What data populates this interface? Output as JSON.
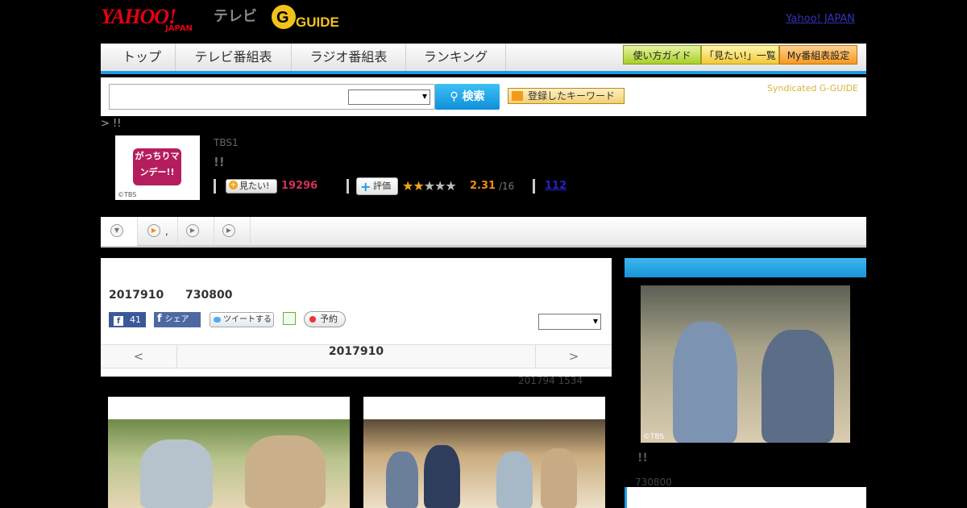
{
  "header": {
    "yahoo_logo": "YAHOO!",
    "yahoo_sub": "JAPAN",
    "tv_label": "テレビ",
    "gguide_logo": "G-GUIDE",
    "top_link": "Yahoo! JAPAN"
  },
  "nav": {
    "tabs": [
      "トップ",
      "テレビ番組表",
      "ラジオ番組表",
      "ランキング"
    ],
    "right_buttons": [
      "使い方ガイド",
      "「見たい!」一覧",
      "My番組表設定"
    ]
  },
  "search": {
    "placeholder": "",
    "button_label": "検索",
    "keyword_button": "登録したキーワード",
    "syndicated": "Syndicated G-GUIDE"
  },
  "breadcrumb": "> !!",
  "program": {
    "thumb_text": "がっちりマンデー!!",
    "thumb_credit": "©TBS",
    "station": "TBS1",
    "title": "!!",
    "mitai_label": "見たい!",
    "mitai_count": "19296",
    "hyoka_label": "評価",
    "rating": 2.31,
    "score": "2.31",
    "out_of": "/16",
    "review_count": "112"
  },
  "subtabs": [
    {
      "label": ""
    },
    {
      "label": ","
    },
    {
      "label": ""
    },
    {
      "label": ""
    }
  ],
  "panel": {
    "date": "2017910",
    "number": "730800",
    "fb_count": "41",
    "share_label": "シェア",
    "tweet_label": "ツイートする",
    "reserve_label": "予約",
    "pager_prev": "<",
    "pager_date": "2017910",
    "pager_next": ">",
    "updated": "201794  1534"
  },
  "side": {
    "credit": "©TBS",
    "title": "!!",
    "number": "730800"
  },
  "colors": {
    "accent_blue": "#1d9ce6",
    "rating_orange": "#f08a17",
    "mitai_pink": "#d0305a"
  }
}
